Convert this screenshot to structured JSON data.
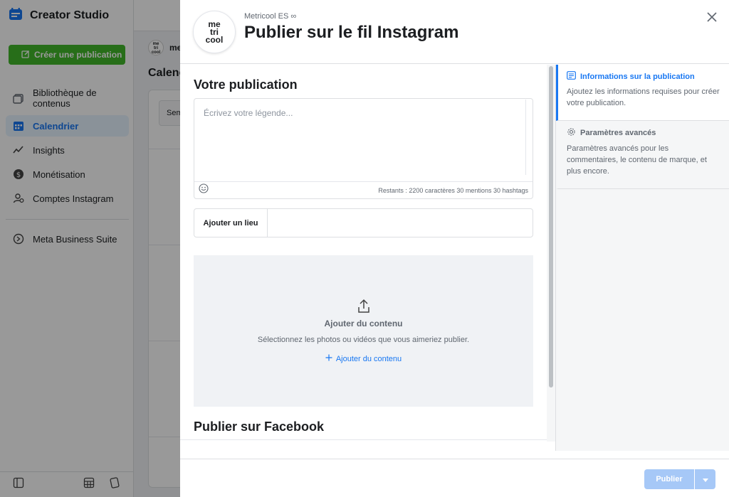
{
  "app": {
    "title": "Creator Studio",
    "create_button": "Créer une publication",
    "nav": [
      {
        "label": "Bibliothèque de contenus",
        "icon": "library-icon"
      },
      {
        "label": "Calendrier",
        "icon": "calendar-icon",
        "active": true
      },
      {
        "label": "Insights",
        "icon": "insights-icon"
      },
      {
        "label": "Monétisation",
        "icon": "dollar-icon"
      },
      {
        "label": "Comptes Instagram",
        "icon": "accounts-icon"
      },
      {
        "label": "Meta Business Suite",
        "icon": "meta-business-icon"
      }
    ],
    "bg_account_label": "me",
    "bg_page_title": "Calenc",
    "bg_tab_label": "Sem"
  },
  "modal": {
    "logo_lines": [
      "me",
      "tri",
      "cool"
    ],
    "account": "Metricool ES ∞",
    "title": "Publier sur le fil Instagram",
    "section_publication": "Votre publication",
    "caption_placeholder": "Écrivez votre légende...",
    "caption_counts": "Restants : 2200 caractères 30 mentions 30 hashtags",
    "location_label": "Ajouter un lieu",
    "upload": {
      "title": "Ajouter du contenu",
      "description": "Sélectionnez les photos ou vidéos que vous aimeriez publier.",
      "link": "Ajouter du contenu"
    },
    "section_facebook": "Publier sur Facebook",
    "steps": [
      {
        "title": "Informations sur la publication",
        "description": "Ajoutez les informations requises pour créer votre publication.",
        "icon": "post-info-icon",
        "active": true
      },
      {
        "title": "Paramètres avancés",
        "description": "Paramètres avancés pour les commentaires, le contenu de marque, et plus encore.",
        "icon": "gear-icon",
        "active": false
      }
    ],
    "publish_button": "Publier",
    "colors": {
      "accent": "#1877f2",
      "create": "#42b72a",
      "publish_disabled": "#a6c8f7"
    }
  }
}
